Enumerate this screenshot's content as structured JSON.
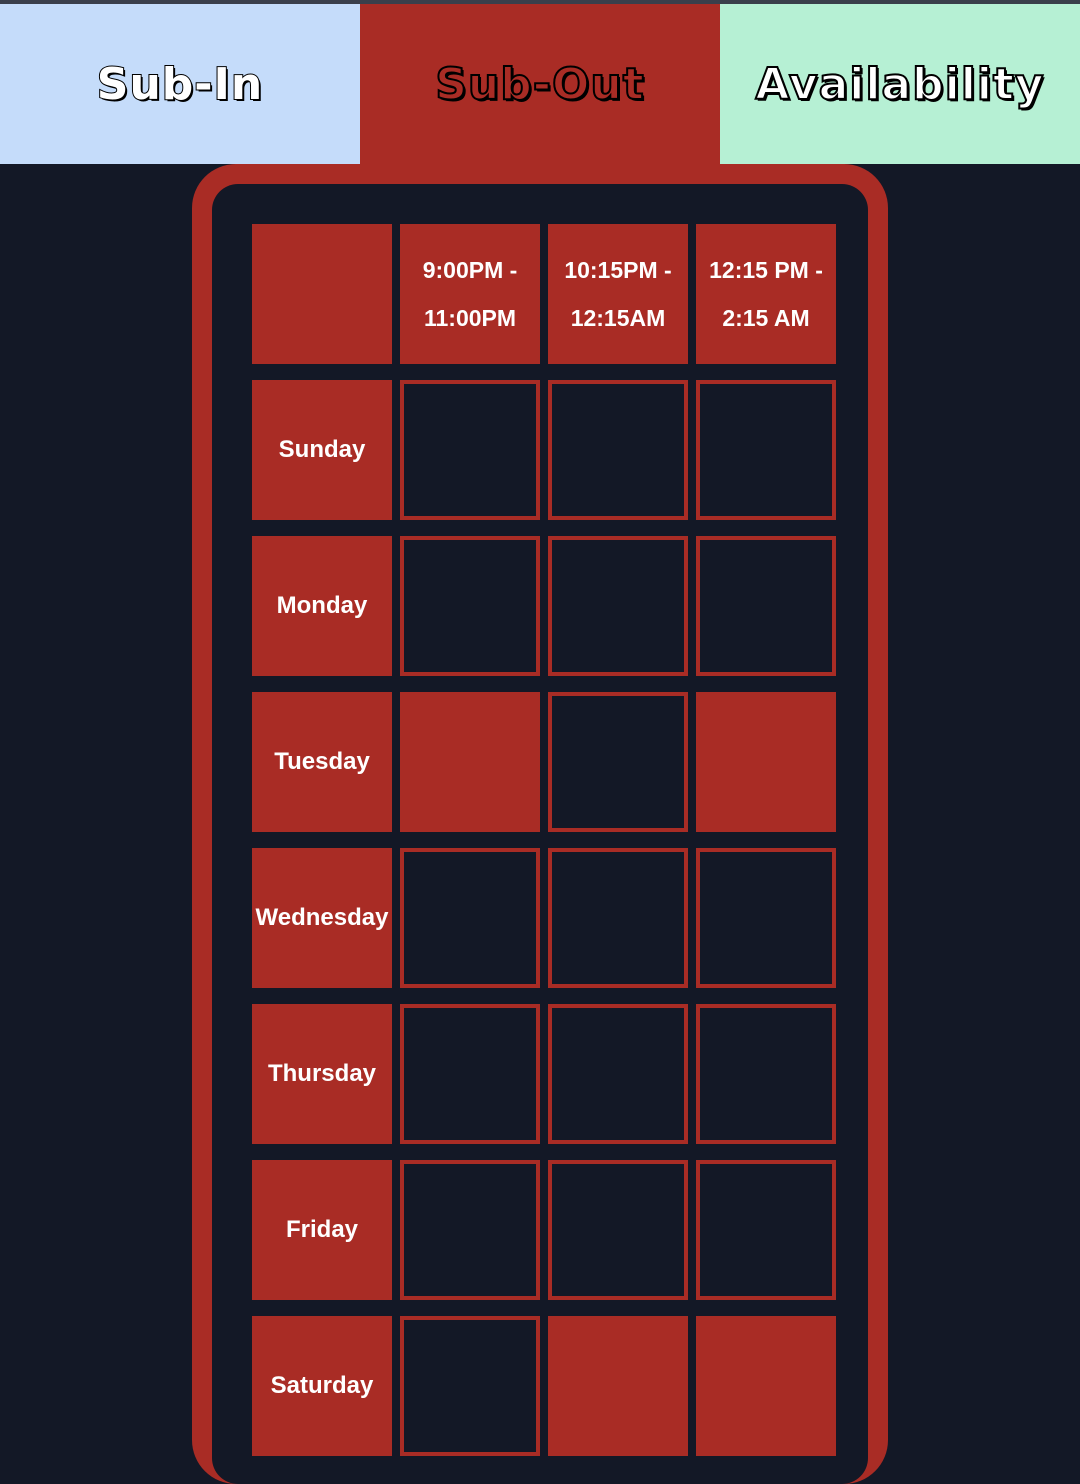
{
  "tabs": [
    {
      "label": "Sub-In"
    },
    {
      "label": "Sub-Out"
    },
    {
      "label": "Availability"
    }
  ],
  "schedule": {
    "time_slots": [
      {
        "line1": "9:00PM -",
        "line2": "11:00PM"
      },
      {
        "line1": "10:15PM -",
        "line2": "12:15AM"
      },
      {
        "line1": "12:15 PM -",
        "line2": "2:15 AM"
      }
    ],
    "days": [
      {
        "name": "Sunday",
        "selected": [
          false,
          false,
          false
        ]
      },
      {
        "name": "Monday",
        "selected": [
          false,
          false,
          false
        ]
      },
      {
        "name": "Tuesday",
        "selected": [
          true,
          false,
          true
        ]
      },
      {
        "name": "Wednesday",
        "selected": [
          false,
          false,
          false
        ]
      },
      {
        "name": "Thursday",
        "selected": [
          false,
          false,
          false
        ]
      },
      {
        "name": "Friday",
        "selected": [
          false,
          false,
          false
        ]
      },
      {
        "name": "Saturday",
        "selected": [
          false,
          true,
          true
        ]
      }
    ]
  },
  "colors": {
    "active_tab": "#a92c25",
    "sub_in_tab": "#c5dcfa",
    "availability_tab": "#b6f0d4",
    "background": "#131826"
  }
}
